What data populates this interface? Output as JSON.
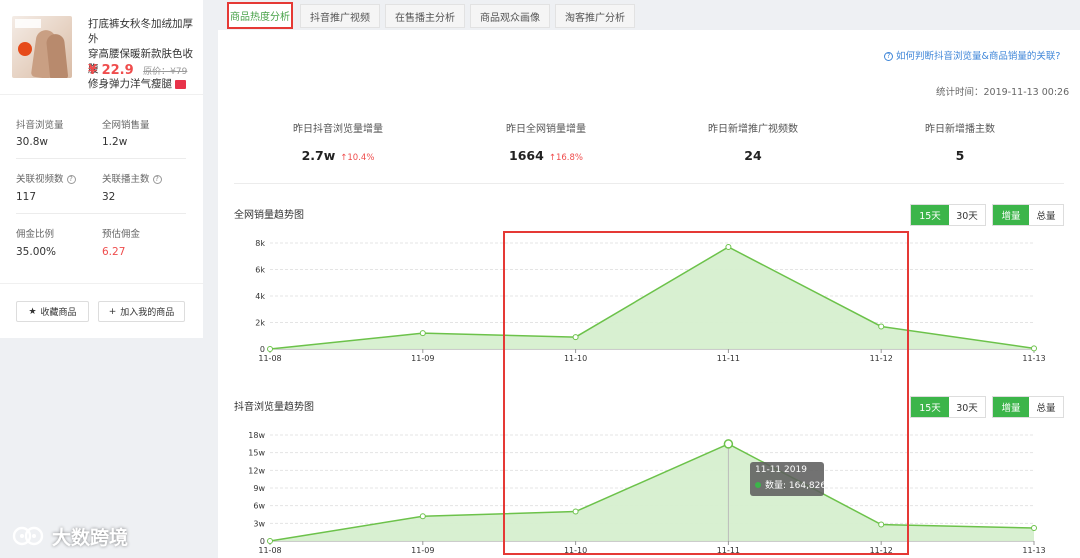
{
  "product": {
    "title_lines": [
      "打底裤女秋冬加绒加厚外",
      "穿高腰保暖新款肤色收腹",
      "修身弹力洋气瘦腿"
    ],
    "price": "¥ 22.9",
    "original_price": "原价：¥79",
    "stats": [
      {
        "label": "抖音浏览量",
        "value": "30.8w"
      },
      {
        "label": "全网销售量",
        "value": "1.2w"
      },
      {
        "label": "关联视频数",
        "value": "117"
      },
      {
        "label": "关联播主数",
        "value": "32"
      },
      {
        "label": "佣金比例",
        "value": "35.00%"
      },
      {
        "label": "预估佣金",
        "value": "6.27"
      }
    ],
    "fav_button": "收藏商品",
    "add_button": "加入我的商品"
  },
  "tabs": [
    "商品热度分析",
    "抖音推广视频",
    "在售播主分析",
    "商品观众画像",
    "淘客推广分析"
  ],
  "help_link": "如何判断抖音浏览量&商品销量的关联?",
  "stat_time": "统计时间：2019-11-13 00:26",
  "kpis": [
    {
      "label": "昨日抖音浏览量增量",
      "value": "2.7w",
      "change": "↑10.4%"
    },
    {
      "label": "昨日全网销量增量",
      "value": "1664",
      "change": "↑16.8%"
    },
    {
      "label": "昨日新增推广视频数",
      "value": "24",
      "change": ""
    },
    {
      "label": "昨日新增播主数",
      "value": "5",
      "change": ""
    }
  ],
  "toggles": {
    "d15": "15天",
    "d30": "30天",
    "inc": "增量",
    "total": "总量"
  },
  "tooltip": {
    "date": "11-11 2019",
    "label": "数量: 164,826"
  },
  "watermark": "大数跨境",
  "colors": {
    "accent": "#3cb54a",
    "line": "#6cc24a",
    "area": "#d6efcf",
    "red": "#e53935",
    "link": "#3f86d8"
  },
  "chart_data": [
    {
      "type": "area",
      "title": "全网销量趋势图",
      "x": [
        "11-08",
        "11-09",
        "11-10",
        "11-11",
        "11-12",
        "11-13"
      ],
      "y_ticks": [
        "0",
        "2k",
        "4k",
        "6k",
        "8k"
      ],
      "ylim": [
        0,
        8000
      ],
      "values": [
        0,
        1200,
        900,
        7700,
        1700,
        50
      ],
      "grid": true
    },
    {
      "type": "area",
      "title": "抖音浏览量趋势图",
      "x": [
        "11-08",
        "11-09",
        "11-10",
        "11-11",
        "11-12",
        "11-13"
      ],
      "y_ticks": [
        "0",
        "3w",
        "6w",
        "9w",
        "12w",
        "15w",
        "18w"
      ],
      "ylim": [
        0,
        180000
      ],
      "values": [
        0,
        42000,
        50000,
        164826,
        28000,
        22000
      ],
      "grid": true
    }
  ]
}
